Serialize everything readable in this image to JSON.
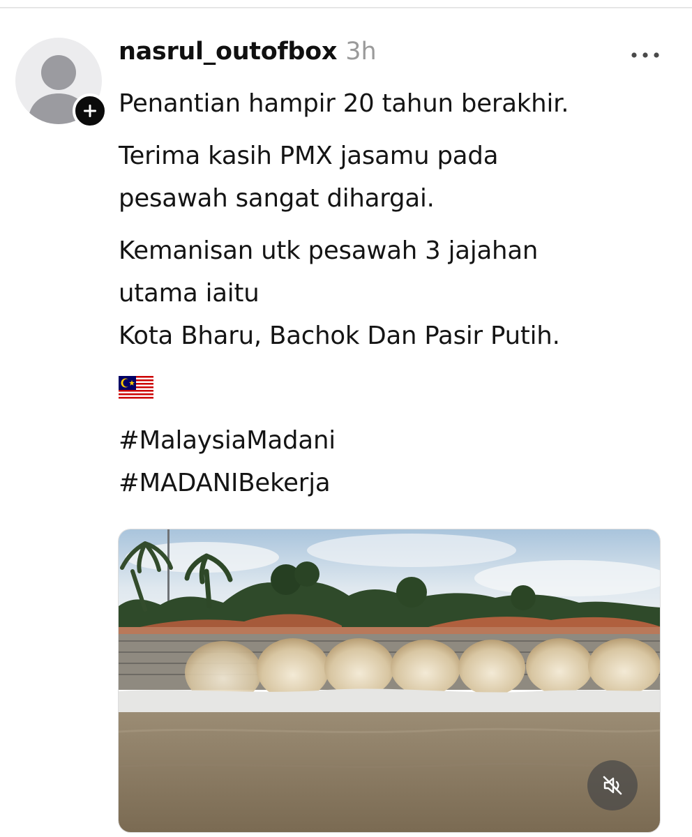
{
  "post": {
    "username": "nasrul_outofbox",
    "timestamp": "3h",
    "lines": {
      "l1": "Penantian hampir 20 tahun berakhir.",
      "l2": "Terima kasih PMX jasamu pada",
      "l3": "pesawah sangat dihargai.",
      "l4": "Kemanisan utk pesawah 3 jajahan",
      "l5": "utama iaitu",
      "l6": "Kota Bharu, Bachok Dan Pasir Putih."
    },
    "hashtags": [
      "#MalaysiaMadani",
      "#MADANIBekerja"
    ]
  },
  "icons": {
    "avatar": "default-user-avatar-icon",
    "follow": "plus-icon",
    "more": "more-horizontal-icon",
    "flag": "malaysia-flag-icon",
    "mute": "volume-muted-icon"
  },
  "colors": {
    "text": "#141414",
    "timestamp": "#9a9a9a",
    "badge": "#0b0b0b"
  }
}
